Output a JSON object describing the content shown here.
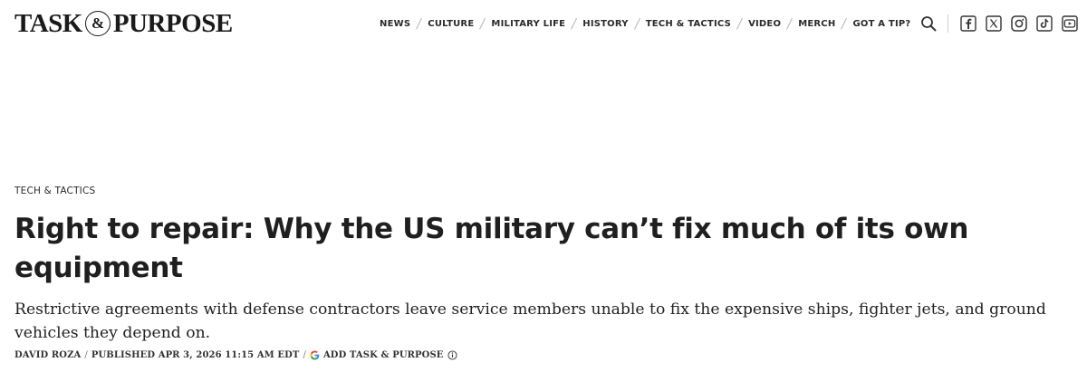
{
  "brand": {
    "logo_left": "TASK",
    "logo_amp": "&",
    "logo_right": "PURPOSE"
  },
  "nav": {
    "items": [
      {
        "label": "NEWS"
      },
      {
        "label": "CULTURE"
      },
      {
        "label": "MILITARY LIFE"
      },
      {
        "label": "HISTORY"
      },
      {
        "label": "TECH & TACTICS"
      },
      {
        "label": "VIDEO"
      },
      {
        "label": "MERCH"
      },
      {
        "label": "GOT A TIP?"
      }
    ],
    "separator": "/"
  },
  "icons": {
    "search": "search-icon",
    "social": [
      "facebook-icon",
      "x-icon",
      "instagram-icon",
      "tiktok-icon",
      "youtube-icon"
    ]
  },
  "article": {
    "kicker": "TECH & TACTICS",
    "headline": "Right to repair: Why the US military can’t fix much of its own equipment",
    "dek": "Restrictive agreements with defense contractors leave service members unable to fix the expensive ships, fighter jets, and ground vehicles they depend on.",
    "byline": {
      "author": "DAVID ROZA",
      "published": "PUBLISHED APR 3, 2026 11:15 AM EDT",
      "add_source": "ADD TASK & PURPOSE",
      "separator": "/"
    }
  },
  "colors": {
    "text": "#1a1a1a",
    "nav_separator": "#bdbdbd",
    "google_blue": "#4285F4",
    "google_red": "#EA4335",
    "google_yellow": "#FBBC05",
    "google_green": "#34A853"
  }
}
